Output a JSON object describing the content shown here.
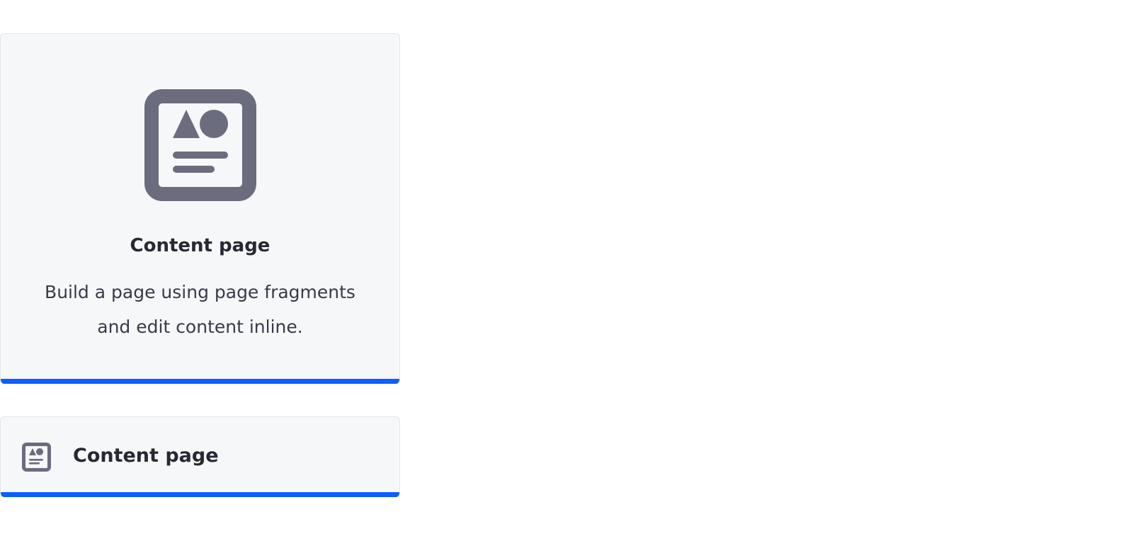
{
  "cards": {
    "large": {
      "icon": "content-page-icon",
      "title": "Content page",
      "description": "Build a page using page fragments and edit content inline."
    },
    "small": {
      "icon": "content-page-icon",
      "title": "Content page"
    }
  },
  "colors": {
    "card_background": "#f6f7f9",
    "card_border": "#e3e5e9",
    "accent": "#0b5fff",
    "icon": "#6b6c7e",
    "title_text": "#272833",
    "body_text": "#393a4a"
  }
}
